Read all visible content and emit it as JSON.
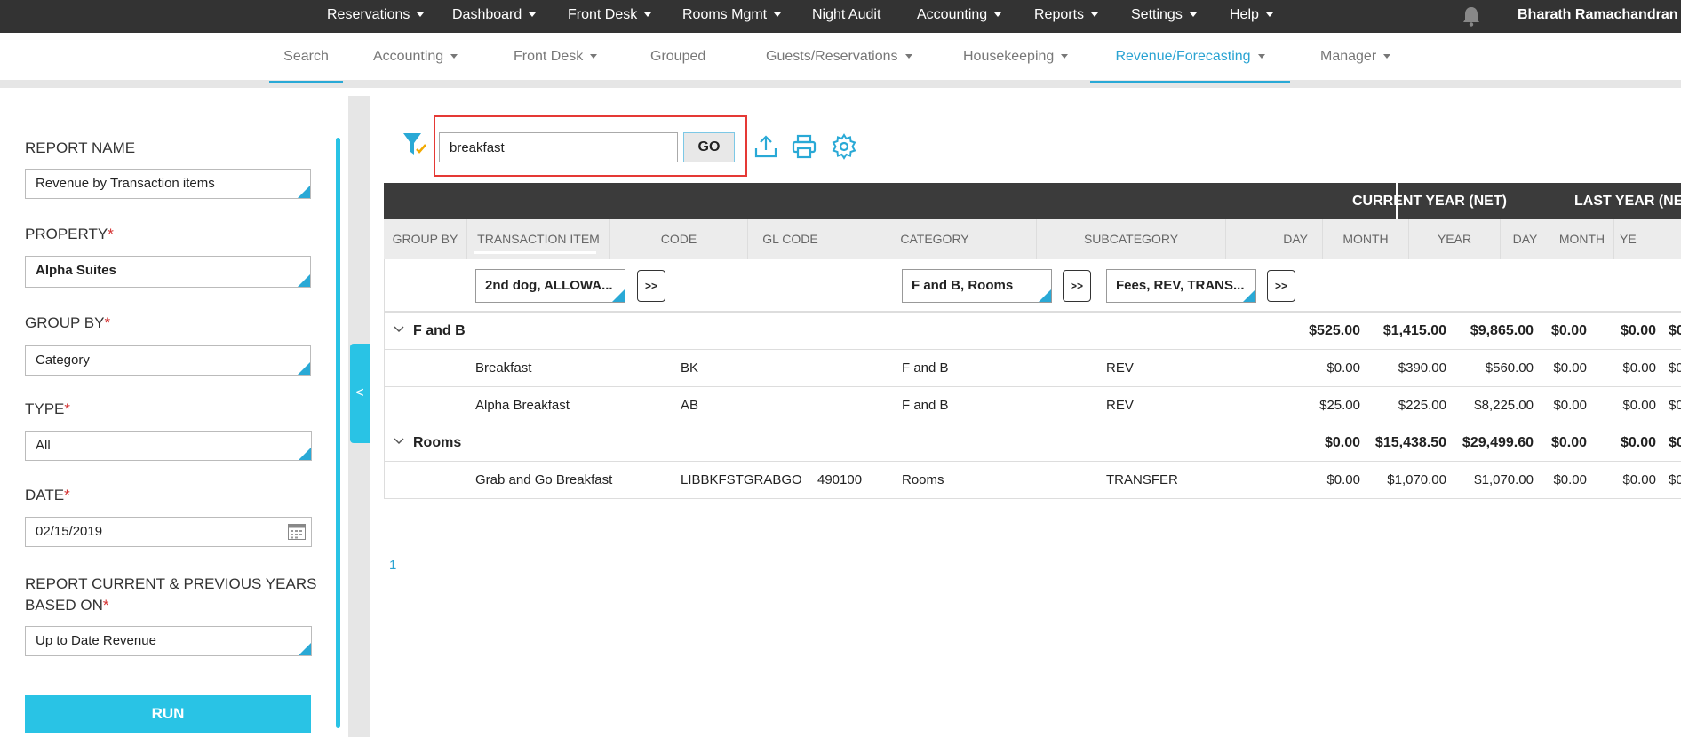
{
  "topnav": {
    "items": [
      "Reservations",
      "Dashboard",
      "Front Desk",
      "Rooms Mgmt",
      "Night Audit",
      "Accounting",
      "Reports",
      "Settings",
      "Help"
    ],
    "user": "Bharath Ramachandran"
  },
  "subnav": {
    "items": [
      "Search",
      "Accounting",
      "Front Desk",
      "Grouped",
      "Guests/Reservations",
      "Housekeeping",
      "Revenue/Forecasting",
      "Manager"
    ],
    "active": "Revenue/Forecasting"
  },
  "form": {
    "report_name_label": "REPORT NAME",
    "report_name_value": "Revenue by Transaction items",
    "property_label": "PROPERTY",
    "property_value": "Alpha Suites",
    "group_by_label": "GROUP BY",
    "group_by_value": "Category",
    "type_label": "TYPE",
    "type_value": "All",
    "date_label": "DATE",
    "date_value": "02/15/2019",
    "basis_label_1": "REPORT CURRENT & PREVIOUS YEARS",
    "basis_label_2": "BASED ON",
    "basis_value": "Up to Date Revenue",
    "required_mark": "*",
    "run_label": "RUN",
    "collapse_glyph": "<"
  },
  "toolbar": {
    "search_value": "breakfast",
    "go_label": "GO"
  },
  "table": {
    "current_year_label": "CURRENT YEAR (NET)",
    "last_year_label": "LAST YEAR (NET)",
    "columns": {
      "group_by": "GROUP BY",
      "transaction_item": "TRANSACTION ITEM",
      "code": "CODE",
      "gl_code": "GL CODE",
      "category": "CATEGORY",
      "subcategory": "SUBCATEGORY",
      "day": "DAY",
      "month": "MONTH",
      "year": "YEAR",
      "ly_day": "DAY",
      "ly_month": "MONTH",
      "ly_year": "YE"
    },
    "filters": {
      "transaction_item": "2nd dog, ALLOWA...",
      "category": "F and B, Rooms",
      "subcategory": "Fees, REV, TRANS...",
      "more_label": ">>"
    },
    "groups": [
      {
        "name": "F and B",
        "day": "$525.00",
        "month": "$1,415.00",
        "year": "$9,865.00",
        "ly_day": "$0.00",
        "ly_month": "$0.00",
        "ly_year": "$0",
        "rows": [
          {
            "item": "Breakfast",
            "code": "BK",
            "gl": "",
            "category": "F and B",
            "subcategory": "REV",
            "day": "$0.00",
            "month": "$390.00",
            "year": "$560.00",
            "ly_day": "$0.00",
            "ly_month": "$0.00",
            "ly_year": "$0"
          },
          {
            "item": "Alpha Breakfast",
            "code": "AB",
            "gl": "",
            "category": "F and B",
            "subcategory": "REV",
            "day": "$25.00",
            "month": "$225.00",
            "year": "$8,225.00",
            "ly_day": "$0.00",
            "ly_month": "$0.00",
            "ly_year": "$0"
          }
        ]
      },
      {
        "name": "Rooms",
        "day": "$0.00",
        "month": "$15,438.50",
        "year": "$29,499.60",
        "ly_day": "$0.00",
        "ly_month": "$0.00",
        "ly_year": "$0",
        "rows": [
          {
            "item": "Grab and Go Breakfast",
            "code": "LIBBKFSTGRABGO",
            "gl": "490100",
            "category": "Rooms",
            "subcategory": "TRANSFER",
            "day": "$0.00",
            "month": "$1,070.00",
            "year": "$1,070.00",
            "ly_day": "$0.00",
            "ly_month": "$0.00",
            "ly_year": "$0"
          }
        ]
      }
    ],
    "page": "1"
  },
  "colors": {
    "accent": "#29c3e5",
    "link": "#2aa3d2",
    "header_dark": "#3b3b3b",
    "required": "#d32f2f",
    "highlight_box": "#e53935"
  },
  "icons": [
    "bell-icon",
    "filter-check-icon",
    "upload-icon",
    "print-icon",
    "gear-icon",
    "calendar-icon",
    "chevron-down-icon"
  ]
}
